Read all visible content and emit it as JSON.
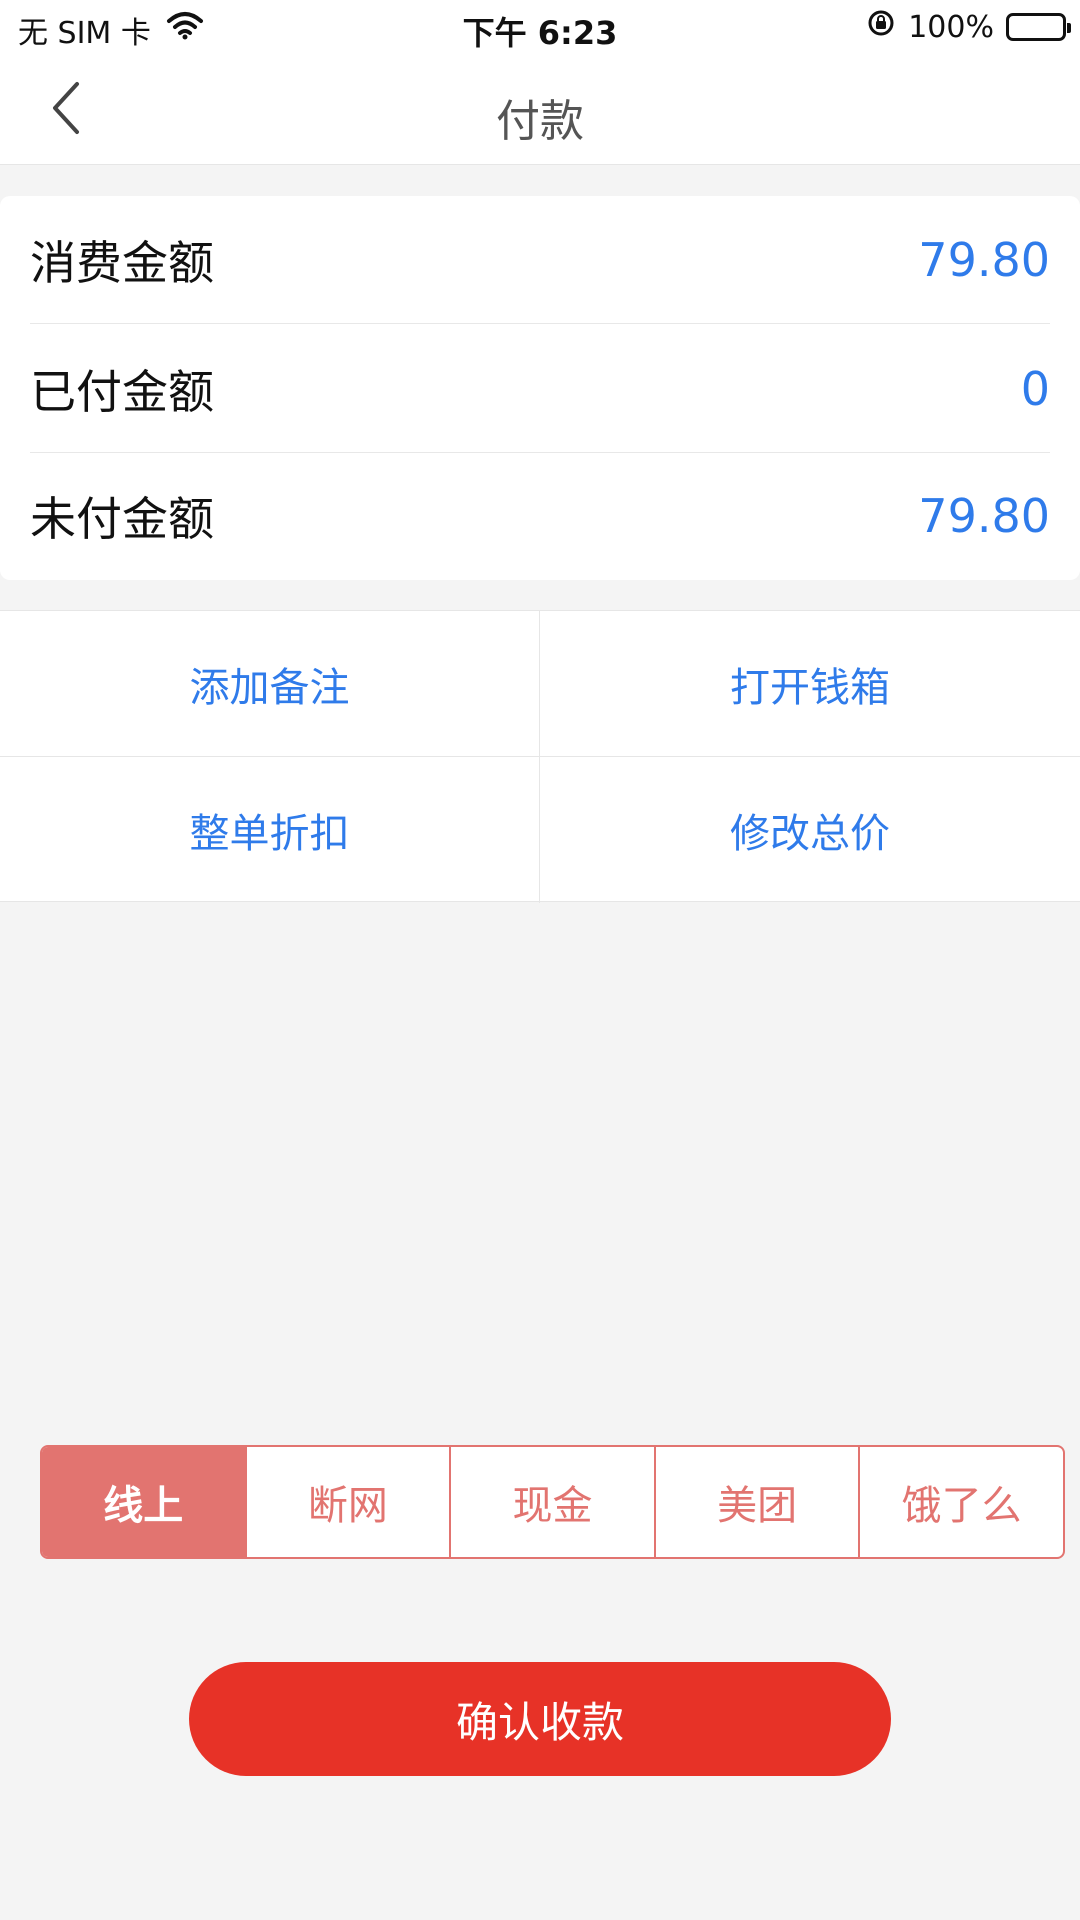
{
  "status_bar": {
    "carrier": "无 SIM 卡",
    "time": "下午 6:23",
    "battery": "100%"
  },
  "nav": {
    "title": "付款"
  },
  "amounts": [
    {
      "label": "消费金额",
      "value": "79.80"
    },
    {
      "label": "已付金额",
      "value": "0"
    },
    {
      "label": "未付金额",
      "value": "79.80"
    }
  ],
  "actions": [
    {
      "label": "添加备注"
    },
    {
      "label": "打开钱箱"
    },
    {
      "label": "整单折扣"
    },
    {
      "label": "修改总价"
    }
  ],
  "payment_methods": [
    {
      "label": "线上",
      "selected": true
    },
    {
      "label": "断网",
      "selected": false
    },
    {
      "label": "现金",
      "selected": false
    },
    {
      "label": "美团",
      "selected": false
    },
    {
      "label": "饿了么",
      "selected": false
    }
  ],
  "confirm_label": "确认收款",
  "colors": {
    "accent_blue": "#2f7bea",
    "method_red": "#e27470",
    "confirm_red": "#e73227"
  },
  "icons": {
    "back": "chevron-left-icon",
    "wifi": "wifi-icon",
    "rotation_lock": "rotation-lock-icon",
    "battery": "battery-icon"
  }
}
